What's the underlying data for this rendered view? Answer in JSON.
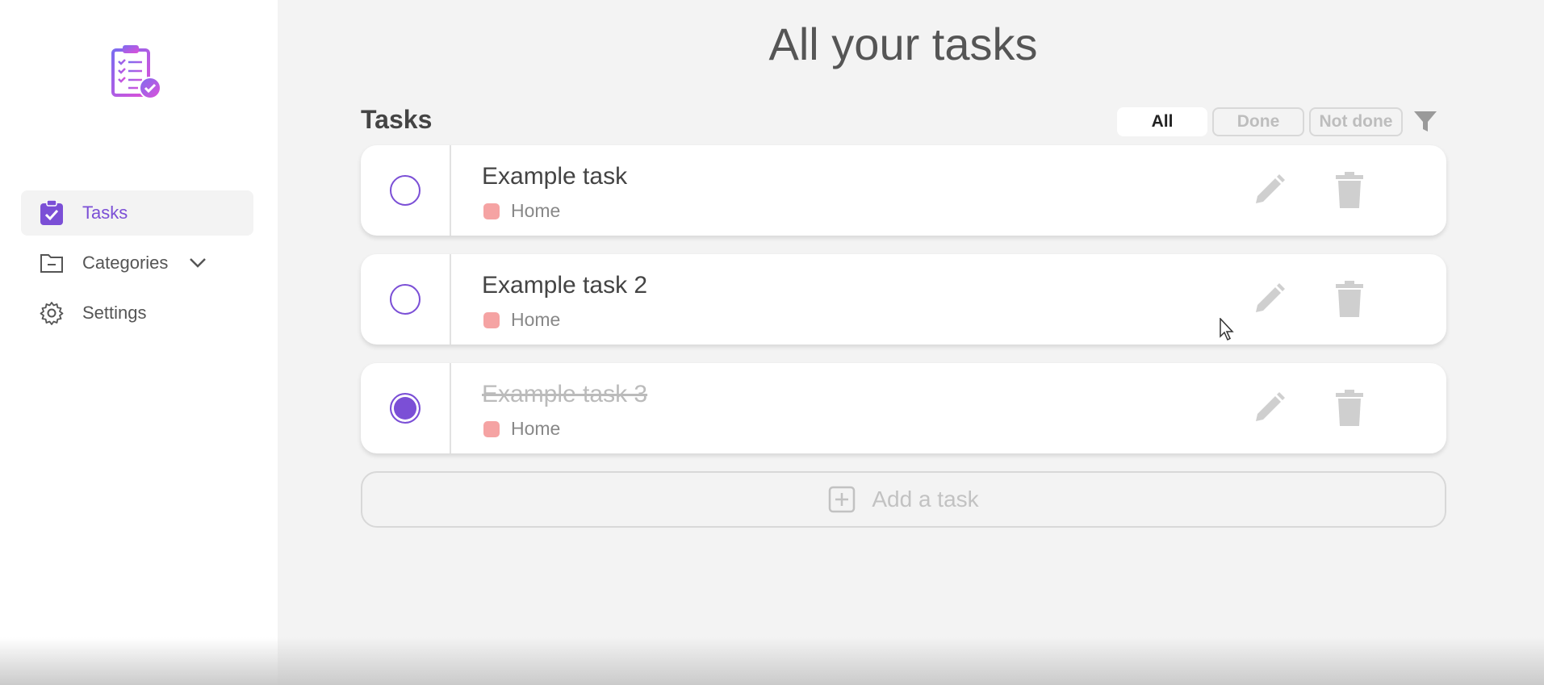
{
  "sidebar": {
    "logo_icon": "clipboard-check-icon",
    "items": [
      {
        "label": "Tasks",
        "icon": "clipboard-check-icon",
        "active": true
      },
      {
        "label": "Categories",
        "icon": "folder-icon",
        "active": false
      },
      {
        "label": "Settings",
        "icon": "gear-icon",
        "active": false
      }
    ]
  },
  "main": {
    "page_title": "All your tasks",
    "section_title": "Tasks",
    "filters": [
      {
        "label": "All",
        "active": true
      },
      {
        "label": "Done",
        "active": false
      },
      {
        "label": "Not done",
        "active": false
      }
    ],
    "tasks": [
      {
        "title": "Example task",
        "category": "Home",
        "done": false
      },
      {
        "title": "Example task 2",
        "category": "Home",
        "done": false
      },
      {
        "title": "Example task 3",
        "category": "Home",
        "done": true
      }
    ],
    "add_task_label": "Add a task"
  },
  "colors": {
    "accent": "#7b4fd6",
    "category_home": "#f5a3a3",
    "background": "#f3f3f3",
    "sidebar": "#ffffff"
  }
}
